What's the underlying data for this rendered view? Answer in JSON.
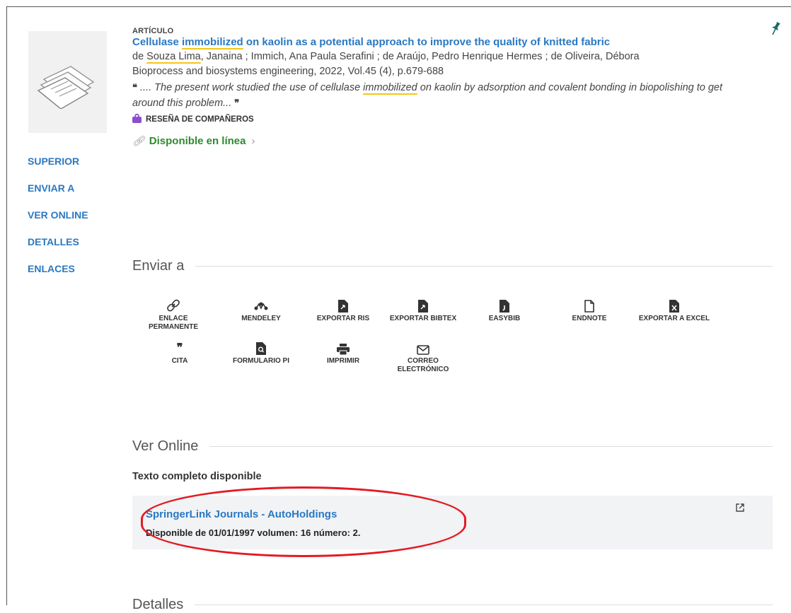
{
  "nav": [
    "SUPERIOR",
    "ENVIAR A",
    "VER ONLINE",
    "DETALLES",
    "ENLACES"
  ],
  "record": {
    "type": "ARTÍCULO",
    "title_pre": "Cellulase ",
    "title_hl": "immobilized",
    "title_post": " on kaolin as a potential approach to improve the quality of knitted fabric",
    "authors_pre": "de ",
    "authors_hl": "Souza Lima",
    "authors_post": ", Janaina ; Immich, Ana Paula Serafini ; de Araújo, Pedro Henrique Hermes ; de Oliveira, Débora",
    "source": "Bioprocess and biosystems engineering, 2022, Vol.45 (4), p.679-688",
    "open_quote": "❝",
    "snippet_pre": " .... The present work studied the use of cellulase ",
    "snippet_hl": "immobilized",
    "snippet_post": " on kaolin by adsorption and covalent bonding in biopolishing to get around this problem... ",
    "close_quote": "❞",
    "peer_review": "RESEÑA DE COMPAÑEROS",
    "online_label": "Disponible en línea"
  },
  "sections": {
    "send_to": "Enviar a",
    "view_online": "Ver Online",
    "details": "Detalles"
  },
  "actions": [
    {
      "label": "ENLACE PERMANENTE",
      "icon": "permalink-icon"
    },
    {
      "label": "MENDELEY",
      "icon": "mendeley-icon"
    },
    {
      "label": "EXPORTAR RIS",
      "icon": "ris-file-icon"
    },
    {
      "label": "EXPORTAR BIBTEX",
      "icon": "bibtex-file-icon"
    },
    {
      "label": "EASYBIB",
      "icon": "easybib-file-icon"
    },
    {
      "label": "ENDNOTE",
      "icon": "endnote-file-icon"
    },
    {
      "label": "EXPORTAR A EXCEL",
      "icon": "excel-file-icon"
    },
    {
      "label": "CITA",
      "icon": "quote-icon"
    },
    {
      "label": "FORMULARIO PI",
      "icon": "form-search-icon"
    },
    {
      "label": "IMPRIMIR",
      "icon": "printer-icon"
    },
    {
      "label": "CORREO ELECTRÓNICO",
      "icon": "envelope-icon"
    }
  ],
  "fulltext": {
    "heading": "Texto completo disponible",
    "provider": "SpringerLink Journals - AutoHoldings",
    "availability": "Disponible de 01/01/1997 volumen: 16 número: 2."
  },
  "colors": {
    "link": "#2a78c2",
    "available": "#2e8b2e",
    "highlight": "#f5c518",
    "annotation": "#e31b23"
  }
}
